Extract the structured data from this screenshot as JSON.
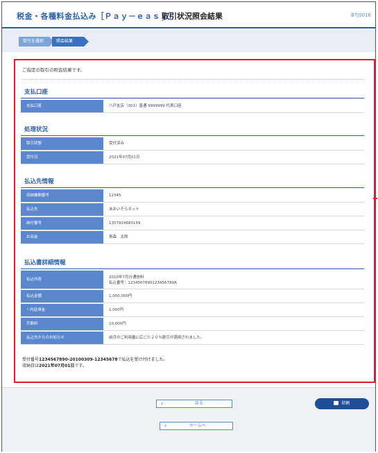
{
  "header": {
    "title": "税金・各種料金払込み［Ｐａｙ－ｅａｓｙ］",
    "subtitle": "取引状況照会結果",
    "screen_code": "BTJS016"
  },
  "steps": [
    "取引を選択",
    "照会結果"
  ],
  "intro": "ご指定の取引の照会結果です。",
  "sections": {
    "payment_account": {
      "title": "支払口座",
      "rows": [
        {
          "label": "支払口座",
          "value": "八戸支店（301）普通 9999999 代表口座"
        }
      ]
    },
    "status": {
      "title": "処理状況",
      "rows": [
        {
          "label": "取引状態",
          "value": "受付済み"
        },
        {
          "label": "受付日",
          "value": "2021年07月01日"
        }
      ]
    },
    "payee": {
      "title": "払込先情報",
      "rows": [
        {
          "label": "収納機関番号",
          "value": "12345"
        },
        {
          "label": "払込先",
          "value": "あおいそらネット"
        },
        {
          "label": "納付番号",
          "value": "1357924680159"
        },
        {
          "label": "お名前",
          "value": "青森　太郎"
        }
      ]
    },
    "details": {
      "title": "払込書詳細情報",
      "rows": [
        {
          "label": "払込内容",
          "value_line1": "2010年7月分通信料",
          "value_line2": "払込番号：1234567890123456789A"
        },
        {
          "label": "払込金額",
          "value": "1,000,000円"
        },
        {
          "label": "└ 内延滞金",
          "value": "1,000円"
        },
        {
          "label": "手数料",
          "value": "10,000円"
        },
        {
          "label": "払込先からのお知らせ",
          "value": "前月のご利用量に応じた２０％割引が適用されました。"
        }
      ]
    }
  },
  "summary": {
    "line1_prefix": "受付番号",
    "receipt_number": "1234567890-20100309-12345678",
    "line1_suffix": "で払込を受け付けました。",
    "line2_prefix": "収納日は",
    "receipt_date": "2021年07月01日",
    "line2_suffix": "です。"
  },
  "buttons": {
    "back": "戻る",
    "home": "ホームへ",
    "print": "印刷"
  },
  "colors": {
    "accent": "#2a5fa8",
    "label_bg": "#5b87cf",
    "highlight_border": "#e3182d",
    "print_button": "#1f4d96"
  }
}
